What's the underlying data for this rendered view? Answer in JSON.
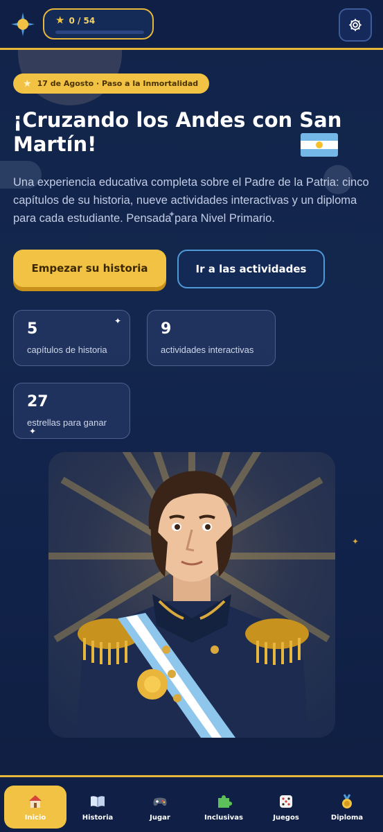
{
  "header": {
    "stars_progress_text": "0 / 54",
    "stars_progress_fraction": 0.0
  },
  "hero": {
    "badge": "17 de Agosto · Paso a la Inmortalidad",
    "title": "¡Cruzando los Andes con San Martín!",
    "subtitle": "Una experiencia educativa completa sobre el Padre de la Patria: cinco capítulos de su historia, nueve actividades interactivas y un diploma para cada estudiante. Pensada para Nivel Primario.",
    "start_button": "Empezar su historia",
    "activities_button": "Ir a las actividades"
  },
  "stats": [
    {
      "value": "5",
      "label": "capítulos de historia"
    },
    {
      "value": "9",
      "label": "actividades interactivas"
    },
    {
      "value": "27",
      "label": "estrellas para ganar"
    }
  ],
  "nav": {
    "items": [
      {
        "label": "Inicio",
        "icon": "house-icon",
        "active": true
      },
      {
        "label": "Historia",
        "icon": "book-icon",
        "active": false
      },
      {
        "label": "Jugar",
        "icon": "gamepad-icon",
        "active": false
      },
      {
        "label": "Inclusivas",
        "icon": "puzzle-icon",
        "active": false
      },
      {
        "label": "Juegos",
        "icon": "dice-icon",
        "active": false
      },
      {
        "label": "Diploma",
        "icon": "medal-icon",
        "active": false
      }
    ]
  },
  "colors": {
    "accent": "#f1c244",
    "background": "#12244a",
    "outline_blue": "#4e9ad8"
  }
}
